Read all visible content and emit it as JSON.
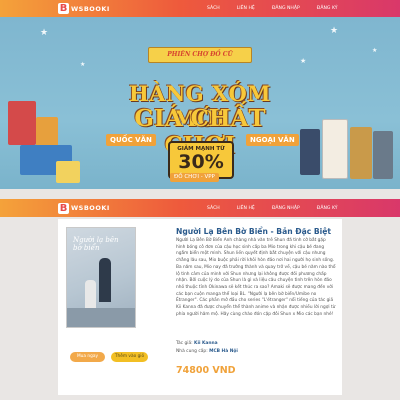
{
  "brand": {
    "logo_letter": "B",
    "name": "WSBOOKI"
  },
  "nav": {
    "items": [
      "SÁCH",
      "LIÊN HỆ",
      "ĐĂNG NHẬP",
      "ĐĂNG KÝ"
    ]
  },
  "banner": {
    "ribbon": "PHIÊN CHỢ ĐỒ CŨ",
    "headline_1": "HÀNG XÓM MỚI",
    "headline_2": "GIÁ CHẤT CHƠI",
    "discount_label": "GIẢM MẠNH TỪ",
    "discount_value": "30%",
    "tag_left": "QUỐC VĂN",
    "tag_right": "NGOẠI VĂN",
    "sub_tag": "ĐỒ CHƠI - VPP"
  },
  "book": {
    "cover_text": "Người lạ bên bờ biển",
    "title": "Người Lạ Bên Bờ Biển - Bản Đặc Biệt",
    "description": "Người Lạ Bên Bờ Biển Anh chàng nhà văn trẻ Shun đã tình cờ bắt gặp hình bóng cô đơn của cậu học sinh cấp ba Mio trong khi cậu bé đang ngắm biển một mình. Shun liền quyết định bắt chuyện với cậu nhưng chẳng lâu sau, Mio buộc phải rời khỏi hòn đảo nơi hai người họ sinh sống. Ba năm sau, Mio nay đã trưởng thành và quay trở về, cậu bé năm nào thổ lộ tình cảm của mình với Shun nhưng lại không được đối phương chấp nhận. Bởi cuộc lý do của Shun là gì và liệu câu chuyện tình trên hòn đảo nhỏ thuộc tỉnh Okinawa sẽ kết thúc ra sao? Amaki sẽ được mang đến với các bạn cuộn manga thể loại BL. \"Người lạ bên bờ biển/Umibe no Étranger\". Các phần mở đầu cho series \"L'étranger\" nổi tiếng của tác giả Kii Kanna đã được chuyển thể thành anime và nhận được nhiều lời ngợi từ phía người hâm mộ. Hãy cùng chào đón cặp đôi Shun x Mio các bạn nhé!",
    "author_label": "Tác giả:",
    "author": "Kii Kanna",
    "publisher_label": "Nhà cung cấp:",
    "publisher": "MCB Hà Nội",
    "price": "74800 VND",
    "buy_label": "Mua ngay",
    "cart_label": "Thêm vào giỏ"
  },
  "colors": {
    "accent_orange": "#f0a23a",
    "title_blue": "#2a5a8c",
    "nav_gradient_start": "#f4a23a",
    "nav_gradient_end": "#d9386a"
  }
}
